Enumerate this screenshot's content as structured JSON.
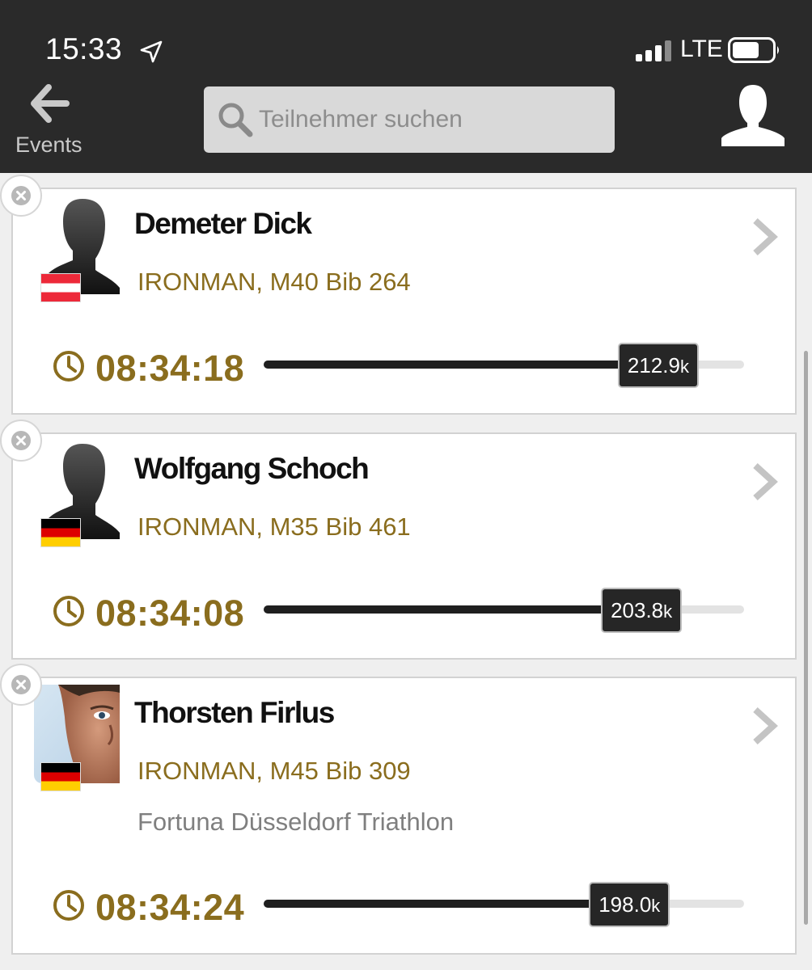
{
  "status_bar": {
    "time": "15:33",
    "network": "LTE"
  },
  "header": {
    "back_label": "Events",
    "search_placeholder": "Teilnehmer suchen",
    "icons": {
      "back": "arrow-left-icon",
      "search": "magnifier-icon",
      "profile": "person-silhouette-icon"
    }
  },
  "colors": {
    "header_bg": "#2a2a2a",
    "accent": "#8a6d1e",
    "progress": "#1f1f1f"
  },
  "athletes": [
    {
      "name": "Demeter Dick",
      "division": "IRONMAN, M40 Bib 264",
      "club": "",
      "flag": "austria",
      "avatar": "silhouette",
      "time": "08:34:18",
      "distance": "212.9",
      "unit": "k",
      "progress": 0.855
    },
    {
      "name": "Wolfgang Schoch",
      "division": "IRONMAN, M35 Bib 461",
      "club": "",
      "flag": "germany",
      "avatar": "silhouette",
      "time": "08:34:08",
      "distance": "203.8",
      "unit": "k",
      "progress": 0.82
    },
    {
      "name": "Thorsten Firlus",
      "division": "IRONMAN, M45 Bib 309",
      "club": "Fortuna Düsseldorf Triathlon",
      "flag": "germany",
      "avatar": "photo",
      "time": "08:34:24",
      "distance": "198.0",
      "unit": "k",
      "progress": 0.795
    }
  ]
}
